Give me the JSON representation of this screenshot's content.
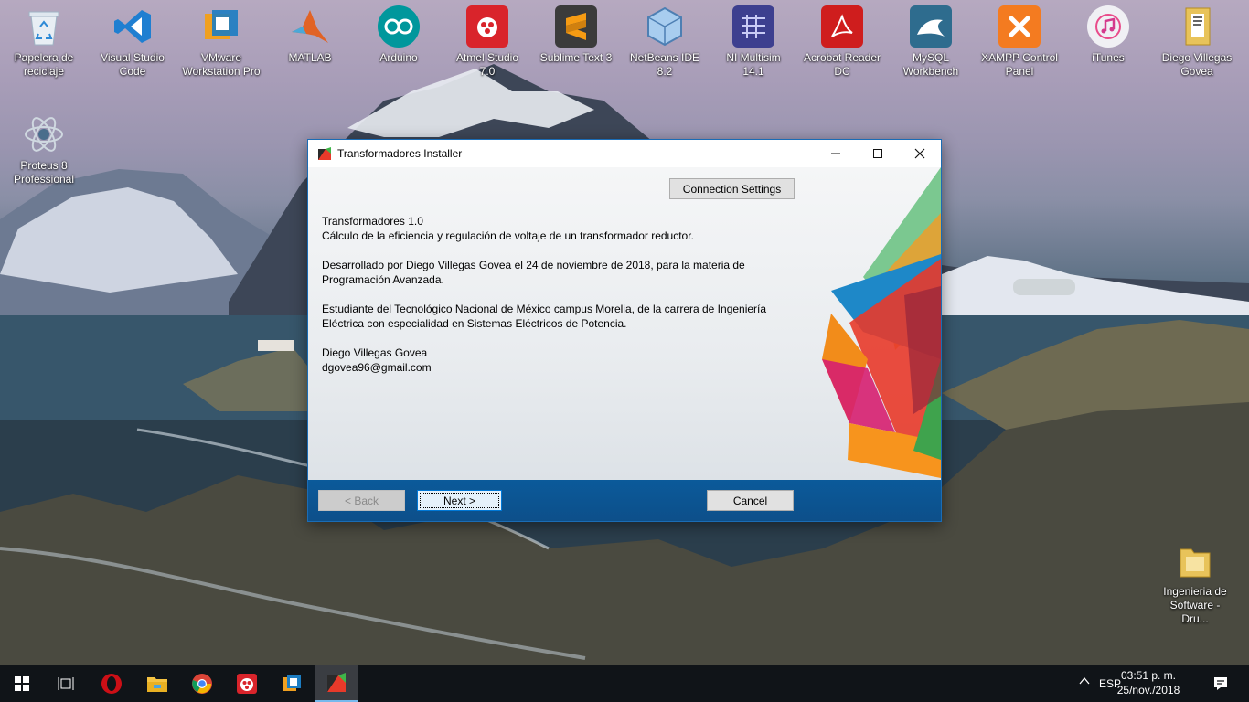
{
  "desktop": {
    "icons": [
      {
        "label": "Papelera de reciclaje",
        "icon": "recycle-bin-icon",
        "color": "#dfe7ee"
      },
      {
        "label": "Visual Studio Code",
        "icon": "vscode-icon",
        "color": "#1f7fd1"
      },
      {
        "label": "VMware Workstation Pro",
        "icon": "vmware-icon",
        "color": "#f0a020"
      },
      {
        "label": "MATLAB",
        "icon": "matlab-icon",
        "color": "#e16325"
      },
      {
        "label": "Arduino",
        "icon": "arduino-icon",
        "color": "#00979c"
      },
      {
        "label": "Atmel Studio 7.0",
        "icon": "atmel-icon",
        "color": "#d9242b"
      },
      {
        "label": "Sublime Text 3",
        "icon": "sublime-icon",
        "color": "#3b3b3b"
      },
      {
        "label": "NetBeans IDE 8.2",
        "icon": "netbeans-icon",
        "color": "#7fb4e3"
      },
      {
        "label": "NI Multisim 14.1",
        "icon": "multisim-icon",
        "color": "#3d3f8f"
      },
      {
        "label": "Acrobat Reader DC",
        "icon": "acrobat-icon",
        "color": "#cf1d1d"
      },
      {
        "label": "MySQL Workbench",
        "icon": "mysql-icon",
        "color": "#2e6c8e"
      },
      {
        "label": "XAMPP Control Panel",
        "icon": "xampp-icon",
        "color": "#f47b20"
      },
      {
        "label": "iTunes",
        "icon": "itunes-icon",
        "color": "#f0f0f4"
      },
      {
        "label": "Diego Villegas Govea",
        "icon": "folder-icon",
        "color": "#e8c35a"
      },
      {
        "label": "Proteus 8 Professional",
        "icon": "proteus-icon",
        "color": "#4a6e8c"
      },
      {
        "label": "Ingenieria de Software - Dru...",
        "icon": "folder-icon",
        "color": "#e8c35a"
      }
    ]
  },
  "dialog": {
    "title": "Transformadores Installer",
    "connection_settings_label": "Connection Settings",
    "info": {
      "name": "Transformadores 1.0",
      "description": "Cálculo de la eficiencia y regulación de voltaje de un transformador reductor.",
      "developed_line1": "Desarrollado por Diego Villegas Govea el 24 de noviembre de 2018, para la materia de",
      "developed_line2": "Programación Avanzada.",
      "student_line1": "Estudiante del Tecnológico Nacional de México campus Morelia, de la carrera de Ingeniería",
      "student_line2": "Eléctrica con especialidad en Sistemas Eléctricos de Potencia.",
      "author": "Diego Villegas Govea",
      "email": "dgovea96@gmail.com"
    },
    "buttons": {
      "back": "< Back",
      "next": "Next >",
      "cancel": "Cancel"
    },
    "footer_color": "#0b5a9a"
  },
  "taskbar": {
    "language": "ESP",
    "time": "03:51 p. m.",
    "date": "25/nov./2018",
    "items": [
      "windows-start-icon",
      "task-view-icon",
      "opera-icon",
      "file-explorer-icon",
      "chrome-icon",
      "atmel-taskbar-icon",
      "vmware-taskbar-icon",
      "installer-taskbar-icon"
    ]
  }
}
